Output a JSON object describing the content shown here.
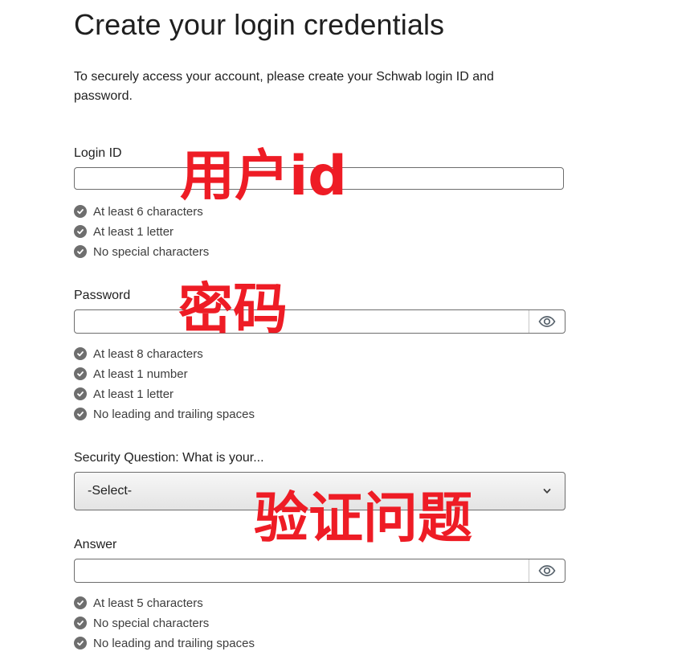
{
  "page": {
    "title": "Create your login credentials",
    "intro": "To securely access your account, please create your Schwab login ID and password."
  },
  "login_id": {
    "label": "Login ID",
    "value": "",
    "rules": [
      "At least 6 characters",
      "At least 1 letter",
      "No special characters"
    ]
  },
  "password": {
    "label": "Password",
    "value": "",
    "toggle_icon": "eye-icon",
    "rules": [
      "At least 8 characters",
      "At least 1 number",
      "At least 1 letter",
      "No leading and trailing spaces"
    ]
  },
  "security_question": {
    "label": "Security Question: What is your...",
    "selected": "-Select-",
    "icon": "chevron-down-icon"
  },
  "answer": {
    "label": "Answer",
    "value": "",
    "toggle_icon": "eye-icon",
    "rules": [
      "At least 5 characters",
      "No special characters",
      "No leading and trailing spaces"
    ]
  },
  "overlays": {
    "login_id": "用户id",
    "password": "密码",
    "security_question": "验证问题"
  },
  "colors": {
    "overlay": "#ee1c25",
    "check_icon": "#6e6e6e",
    "field_border": "#6d6d6d"
  }
}
